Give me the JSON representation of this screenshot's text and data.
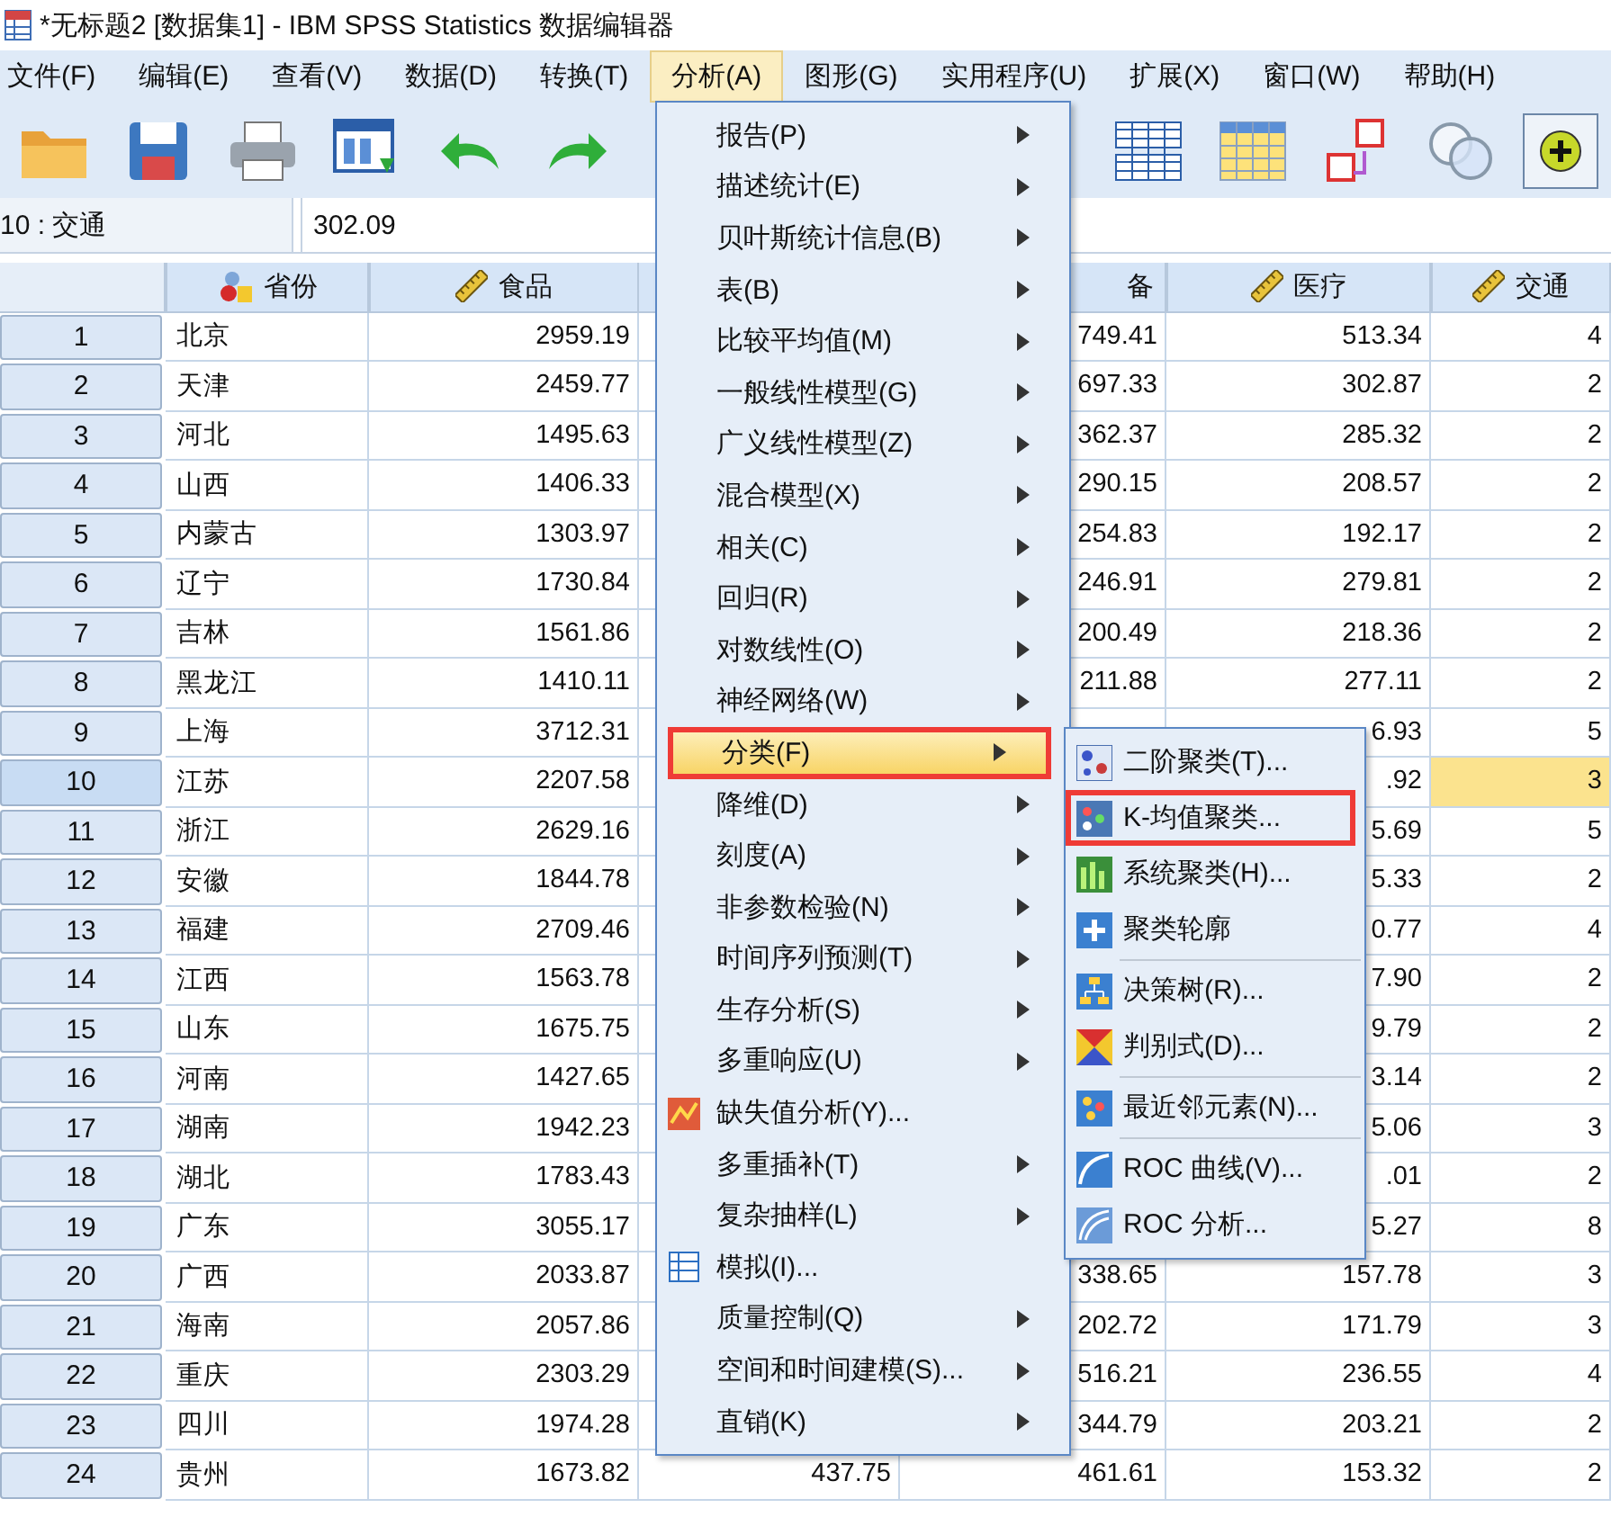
{
  "window": {
    "title": "*无标题2 [数据集1] - IBM SPSS Statistics 数据编辑器"
  },
  "menubar": [
    {
      "label": "文件(F)",
      "selected": false
    },
    {
      "label": "编辑(E)",
      "selected": false
    },
    {
      "label": "查看(V)",
      "selected": false
    },
    {
      "label": "数据(D)",
      "selected": false
    },
    {
      "label": "转换(T)",
      "selected": false
    },
    {
      "label": "分析(A)",
      "selected": true
    },
    {
      "label": "图形(G)",
      "selected": false
    },
    {
      "label": "实用程序(U)",
      "selected": false
    },
    {
      "label": "扩展(X)",
      "selected": false
    },
    {
      "label": "窗口(W)",
      "selected": false
    },
    {
      "label": "帮助(H)",
      "selected": false
    }
  ],
  "cell_bar": {
    "cell": "10 : 交通",
    "value": "302.09"
  },
  "table": {
    "columns": [
      {
        "label": "省份",
        "kind": "nominal"
      },
      {
        "label": "食品",
        "kind": "scale"
      },
      {
        "kind": "covered"
      },
      {
        "label": "备",
        "kind": "cut"
      },
      {
        "label": "医疗",
        "kind": "scale"
      },
      {
        "label": "交通",
        "kind": "scale"
      }
    ],
    "rows": [
      {
        "num": "1",
        "selected": false,
        "cells": [
          "北京",
          "2959.19",
          null,
          "749.41",
          "513.34",
          "4"
        ]
      },
      {
        "num": "2",
        "selected": false,
        "cells": [
          "天津",
          "2459.77",
          null,
          "697.33",
          "302.87",
          "2"
        ]
      },
      {
        "num": "3",
        "selected": false,
        "cells": [
          "河北",
          "1495.63",
          null,
          "362.37",
          "285.32",
          "2"
        ]
      },
      {
        "num": "4",
        "selected": false,
        "cells": [
          "山西",
          "1406.33",
          null,
          "290.15",
          "208.57",
          "2"
        ]
      },
      {
        "num": "5",
        "selected": false,
        "cells": [
          "内蒙古",
          "1303.97",
          null,
          "254.83",
          "192.17",
          "2"
        ]
      },
      {
        "num": "6",
        "selected": false,
        "cells": [
          "辽宁",
          "1730.84",
          null,
          "246.91",
          "279.81",
          "2"
        ]
      },
      {
        "num": "7",
        "selected": false,
        "cells": [
          "吉林",
          "1561.86",
          null,
          "200.49",
          "218.36",
          "2"
        ]
      },
      {
        "num": "8",
        "selected": false,
        "cells": [
          "黑龙江",
          "1410.11",
          null,
          "211.88",
          "277.11",
          "2"
        ]
      },
      {
        "num": "9",
        "selected": false,
        "cells": [
          "上海",
          "3712.31",
          null,
          null,
          "6.93",
          "5"
        ]
      },
      {
        "num": "10",
        "selected": true,
        "cells": [
          "江苏",
          "2207.58",
          null,
          null,
          ".92",
          "3"
        ]
      },
      {
        "num": "11",
        "selected": false,
        "cells": [
          "浙江",
          "2629.16",
          null,
          null,
          "5.69",
          "5"
        ]
      },
      {
        "num": "12",
        "selected": false,
        "cells": [
          "安徽",
          "1844.78",
          null,
          null,
          "5.33",
          "2"
        ]
      },
      {
        "num": "13",
        "selected": false,
        "cells": [
          "福建",
          "2709.46",
          null,
          null,
          "0.77",
          "4"
        ]
      },
      {
        "num": "14",
        "selected": false,
        "cells": [
          "江西",
          "1563.78",
          null,
          null,
          "7.90",
          "2"
        ]
      },
      {
        "num": "15",
        "selected": false,
        "cells": [
          "山东",
          "1675.75",
          null,
          null,
          "9.79",
          "2"
        ]
      },
      {
        "num": "16",
        "selected": false,
        "cells": [
          "河南",
          "1427.65",
          null,
          null,
          "3.14",
          "2"
        ]
      },
      {
        "num": "17",
        "selected": false,
        "cells": [
          "湖南",
          "1942.23",
          null,
          null,
          "5.06",
          "3"
        ]
      },
      {
        "num": "18",
        "selected": false,
        "cells": [
          "湖北",
          "1783.43",
          null,
          null,
          ".01",
          "2"
        ]
      },
      {
        "num": "19",
        "selected": false,
        "cells": [
          "广东",
          "3055.17",
          null,
          null,
          "5.27",
          "8"
        ]
      },
      {
        "num": "20",
        "selected": false,
        "cells": [
          "广西",
          "2033.87",
          null,
          "338.65",
          "157.78",
          "3"
        ]
      },
      {
        "num": "21",
        "selected": false,
        "cells": [
          "海南",
          "2057.86",
          null,
          "202.72",
          "171.79",
          "3"
        ]
      },
      {
        "num": "22",
        "selected": false,
        "cells": [
          "重庆",
          "2303.29",
          null,
          "516.21",
          "236.55",
          "4"
        ]
      },
      {
        "num": "23",
        "selected": false,
        "cells": [
          "四川",
          "1974.28",
          null,
          "344.79",
          "203.21",
          "2"
        ]
      },
      {
        "num": "24",
        "selected": false,
        "cells": [
          "贵州",
          "1673.82",
          "437.75",
          "461.61",
          "153.32",
          "2"
        ]
      }
    ]
  },
  "analyze_menu": {
    "items": [
      {
        "label": "报告(P)",
        "kind": "submenu",
        "selected": false,
        "highlighted": false
      },
      {
        "label": "描述统计(E)",
        "kind": "submenu",
        "selected": false,
        "highlighted": false
      },
      {
        "label": "贝叶斯统计信息(B)",
        "kind": "submenu",
        "selected": false,
        "highlighted": false
      },
      {
        "label": "表(B)",
        "kind": "submenu",
        "selected": false,
        "highlighted": false
      },
      {
        "label": "比较平均值(M)",
        "kind": "submenu",
        "selected": false,
        "highlighted": false
      },
      {
        "label": "一般线性模型(G)",
        "kind": "submenu",
        "selected": false,
        "highlighted": false
      },
      {
        "label": "广义线性模型(Z)",
        "kind": "submenu",
        "selected": false,
        "highlighted": false
      },
      {
        "label": "混合模型(X)",
        "kind": "submenu",
        "selected": false,
        "highlighted": false
      },
      {
        "label": "相关(C)",
        "kind": "submenu",
        "selected": false,
        "highlighted": false
      },
      {
        "label": "回归(R)",
        "kind": "submenu",
        "selected": false,
        "highlighted": false
      },
      {
        "label": "对数线性(O)",
        "kind": "submenu",
        "selected": false,
        "highlighted": false
      },
      {
        "label": "神经网络(W)",
        "kind": "submenu",
        "selected": false,
        "highlighted": false
      },
      {
        "label": "分类(F)",
        "kind": "submenu",
        "selected": true,
        "highlighted": true
      },
      {
        "label": "降维(D)",
        "kind": "submenu",
        "selected": false,
        "highlighted": false
      },
      {
        "label": "刻度(A)",
        "kind": "submenu",
        "selected": false,
        "highlighted": false
      },
      {
        "label": "非参数检验(N)",
        "kind": "submenu",
        "selected": false,
        "highlighted": false
      },
      {
        "label": "时间序列预测(T)",
        "kind": "submenu",
        "selected": false,
        "highlighted": false
      },
      {
        "label": "生存分析(S)",
        "kind": "submenu",
        "selected": false,
        "highlighted": false
      },
      {
        "label": "多重响应(U)",
        "kind": "submenu",
        "selected": false,
        "highlighted": false
      },
      {
        "label": "缺失值分析(Y)...",
        "kind": "command",
        "selected": false,
        "highlighted": false
      },
      {
        "label": "多重插补(T)",
        "kind": "submenu",
        "selected": false,
        "highlighted": false
      },
      {
        "label": "复杂抽样(L)",
        "kind": "submenu",
        "selected": false,
        "highlighted": false
      },
      {
        "label": "模拟(I)...",
        "kind": "command",
        "selected": false,
        "highlighted": false
      },
      {
        "label": "质量控制(Q)",
        "kind": "submenu",
        "selected": false,
        "highlighted": false
      },
      {
        "label": "空间和时间建模(S)...",
        "kind": "submenu",
        "selected": false,
        "highlighted": false
      },
      {
        "label": "直销(K)",
        "kind": "submenu",
        "selected": false,
        "highlighted": false
      }
    ]
  },
  "classify_submenu": {
    "items": [
      {
        "kind": "item",
        "label": "二阶聚类(T)...",
        "highlighted": false
      },
      {
        "kind": "item",
        "label": "K-均值聚类...",
        "highlighted": true
      },
      {
        "kind": "item",
        "label": "系统聚类(H)...",
        "highlighted": false
      },
      {
        "kind": "item",
        "label": "聚类轮廓",
        "highlighted": false
      },
      {
        "kind": "separator"
      },
      {
        "kind": "item",
        "label": "决策树(R)...",
        "highlighted": false
      },
      {
        "kind": "item",
        "label": "判别式(D)...",
        "highlighted": false
      },
      {
        "kind": "separator"
      },
      {
        "kind": "item",
        "label": "最近邻元素(N)...",
        "highlighted": false
      },
      {
        "kind": "separator"
      },
      {
        "kind": "item",
        "label": "ROC 曲线(V)...",
        "highlighted": false
      },
      {
        "kind": "item",
        "label": "ROC 分析...",
        "highlighted": false
      }
    ]
  }
}
